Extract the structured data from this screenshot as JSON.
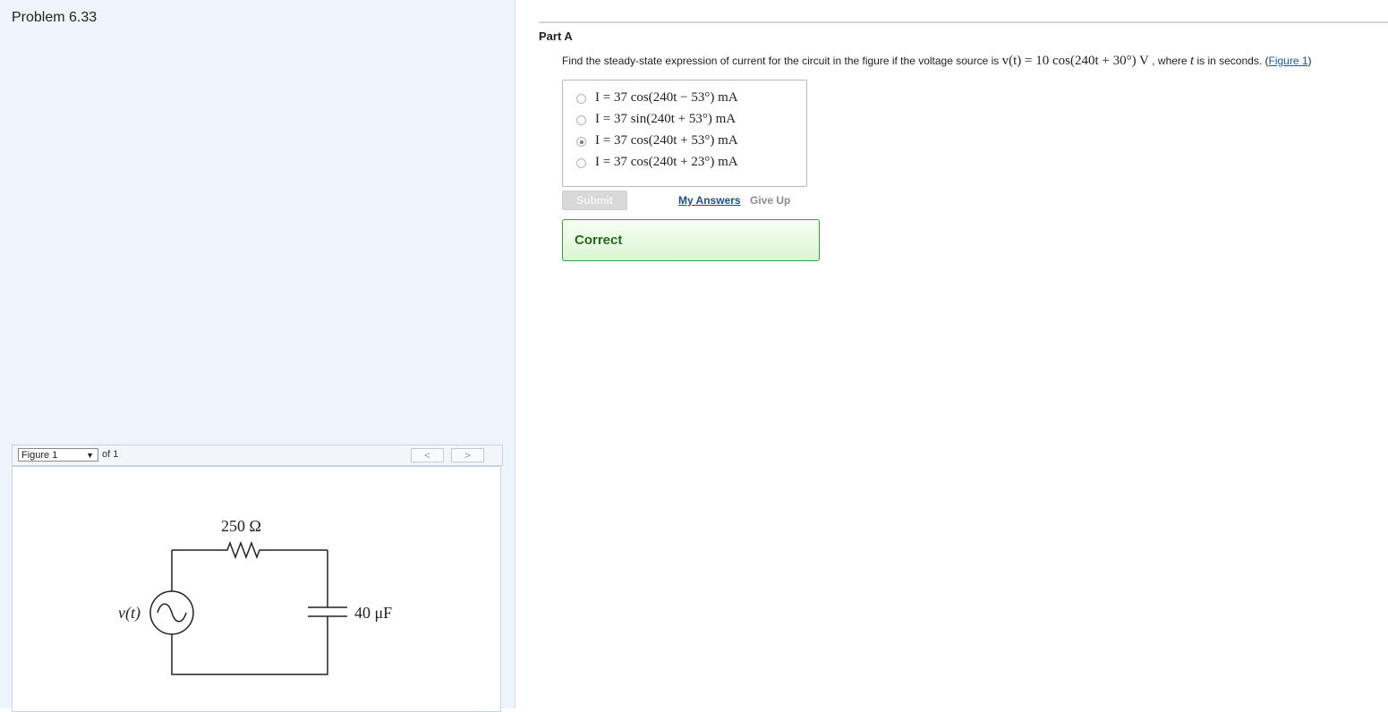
{
  "problem": {
    "title": "Problem 6.33"
  },
  "figure": {
    "select_value": "Figure 1",
    "of_label": "of 1",
    "prev_label": "<",
    "next_label": ">",
    "circuit": {
      "resistor_label": "250 Ω",
      "capacitor_label": "40 μF",
      "source_label": "v(t)"
    }
  },
  "part": {
    "label": "Part A",
    "question_prefix": "Find the steady-state expression of current for the circuit in the figure if the voltage source is",
    "question_math": "v(t) = 10 cos(240t + 30°) V",
    "question_mid": ", where",
    "question_var": "t",
    "question_suffix": "is in seconds.",
    "figure_link": "Figure 1",
    "choices": [
      {
        "label": "I = 37 cos(240t − 53°) mA",
        "selected": false
      },
      {
        "label": "I = 37 sin(240t + 53°) mA",
        "selected": false
      },
      {
        "label": "I = 37 cos(240t + 53°) mA",
        "selected": true
      },
      {
        "label": "I = 37 cos(240t + 23°) mA",
        "selected": false
      }
    ],
    "submit_label": "Submit",
    "my_answers_label": "My Answers",
    "give_up_label": "Give Up",
    "feedback": "Correct"
  }
}
